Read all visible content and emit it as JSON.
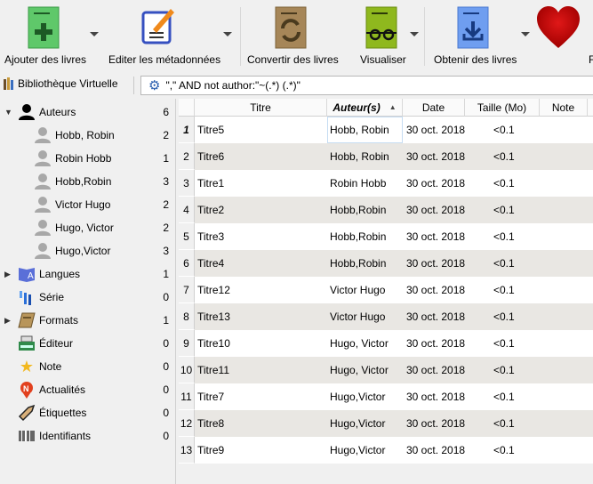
{
  "toolbar": {
    "buttons": [
      {
        "label": "Ajouter des livres",
        "icon": "add-book-icon"
      },
      {
        "label": "Editer les métadonnées",
        "icon": "edit-metadata-icon"
      },
      {
        "label": "Convertir des livres",
        "icon": "convert-book-icon"
      },
      {
        "label": "Visualiser",
        "icon": "view-book-icon"
      },
      {
        "label": "Obtenir des livres",
        "icon": "get-books-icon"
      },
      {
        "label": "F",
        "icon": "heart-icon"
      }
    ]
  },
  "virtual_library": {
    "label": "Bibliothèque Virtuelle"
  },
  "search": {
    "value": "\",\" AND not author:\"~(.*) (.*)\""
  },
  "sidebar": {
    "items": [
      {
        "label": "Auteurs",
        "count": "6",
        "icon": "person-icon",
        "expanded": true,
        "level": 0
      },
      {
        "label": "Hobb, Robin",
        "count": "2",
        "icon": "person-icon",
        "level": 1
      },
      {
        "label": "Robin Hobb",
        "count": "1",
        "icon": "person-icon",
        "level": 1
      },
      {
        "label": "Hobb,Robin",
        "count": "3",
        "icon": "person-icon",
        "level": 1
      },
      {
        "label": "Victor Hugo",
        "count": "2",
        "icon": "person-icon",
        "level": 1
      },
      {
        "label": "Hugo, Victor",
        "count": "2",
        "icon": "person-icon",
        "level": 1
      },
      {
        "label": "Hugo,Victor",
        "count": "3",
        "icon": "person-icon",
        "level": 1
      },
      {
        "label": "Langues",
        "count": "1",
        "icon": "language-icon",
        "collapsed": true,
        "level": 0
      },
      {
        "label": "Série",
        "count": "0",
        "icon": "series-icon",
        "level": 0
      },
      {
        "label": "Formats",
        "count": "1",
        "icon": "format-book-icon",
        "collapsed": true,
        "level": 0
      },
      {
        "label": "Éditeur",
        "count": "0",
        "icon": "typewriter-icon",
        "level": 0
      },
      {
        "label": "Note",
        "count": "0",
        "icon": "star-icon",
        "level": 0
      },
      {
        "label": "Actualités",
        "count": "0",
        "icon": "news-icon",
        "level": 0
      },
      {
        "label": "Étiquettes",
        "count": "0",
        "icon": "tag-icon",
        "level": 0
      },
      {
        "label": "Identifiants",
        "count": "0",
        "icon": "barcode-icon",
        "level": 0
      }
    ]
  },
  "table": {
    "columns": [
      "Titre",
      "Auteur(s)",
      "Date",
      "Taille (Mo)",
      "Note"
    ],
    "sorted_column": "Auteur(s)",
    "rows": [
      {
        "n": "1",
        "title": "Titre5",
        "author": "Hobb, Robin",
        "date": "30 oct. 2018",
        "size": "<0.1"
      },
      {
        "n": "2",
        "title": "Titre6",
        "author": "Hobb, Robin",
        "date": "30 oct. 2018",
        "size": "<0.1"
      },
      {
        "n": "3",
        "title": "Titre1",
        "author": "Robin Hobb",
        "date": "30 oct. 2018",
        "size": "<0.1"
      },
      {
        "n": "4",
        "title": "Titre2",
        "author": "Hobb,Robin",
        "date": "30 oct. 2018",
        "size": "<0.1"
      },
      {
        "n": "5",
        "title": "Titre3",
        "author": "Hobb,Robin",
        "date": "30 oct. 2018",
        "size": "<0.1"
      },
      {
        "n": "6",
        "title": "Titre4",
        "author": "Hobb,Robin",
        "date": "30 oct. 2018",
        "size": "<0.1"
      },
      {
        "n": "7",
        "title": "Titre12",
        "author": "Victor Hugo",
        "date": "30 oct. 2018",
        "size": "<0.1"
      },
      {
        "n": "8",
        "title": "Titre13",
        "author": "Victor Hugo",
        "date": "30 oct. 2018",
        "size": "<0.1"
      },
      {
        "n": "9",
        "title": "Titre10",
        "author": "Hugo, Victor",
        "date": "30 oct. 2018",
        "size": "<0.1"
      },
      {
        "n": "10",
        "title": "Titre11",
        "author": "Hugo, Victor",
        "date": "30 oct. 2018",
        "size": "<0.1"
      },
      {
        "n": "11",
        "title": "Titre7",
        "author": "Hugo,Victor",
        "date": "30 oct. 2018",
        "size": "<0.1"
      },
      {
        "n": "12",
        "title": "Titre8",
        "author": "Hugo,Victor",
        "date": "30 oct. 2018",
        "size": "<0.1"
      },
      {
        "n": "13",
        "title": "Titre9",
        "author": "Hugo,Victor",
        "date": "30 oct. 2018",
        "size": "<0.1"
      }
    ]
  }
}
